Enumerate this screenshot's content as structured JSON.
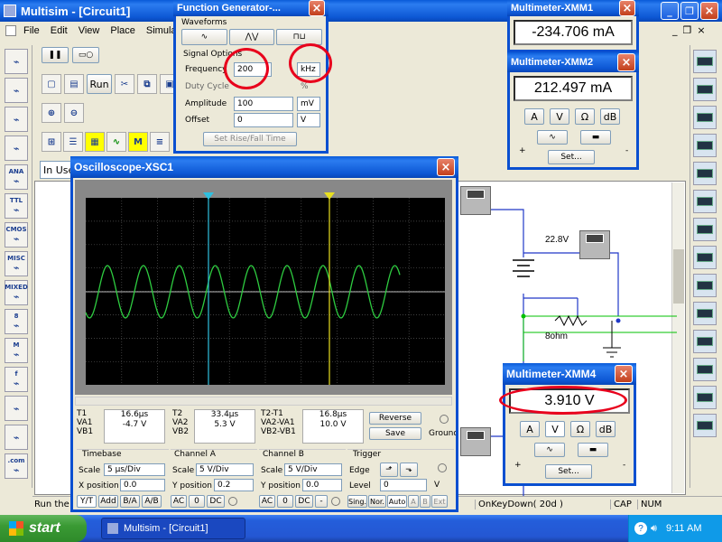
{
  "app": {
    "title": "Multisim - [Circuit1]",
    "menu": [
      "File",
      "Edit",
      "View",
      "Place",
      "Simulat"
    ]
  },
  "toolbar": {
    "run_label": "Run",
    "in_use": "In Use"
  },
  "left_bins": [
    {
      "name": "source-icon",
      "label": ""
    },
    {
      "name": "basic-icon",
      "label": ""
    },
    {
      "name": "diode-icon",
      "label": ""
    },
    {
      "name": "transistor-icon",
      "label": ""
    },
    {
      "name": "analog-icon",
      "label": "ANA"
    },
    {
      "name": "ttl-icon",
      "label": "TTL"
    },
    {
      "name": "cmos-icon",
      "label": "CMOS"
    },
    {
      "name": "misc-icon",
      "label": "MISC"
    },
    {
      "name": "mixed-icon",
      "label": "MIXED"
    },
    {
      "name": "indicator-icon",
      "label": "8"
    },
    {
      "name": "misc2-icon",
      "label": "M"
    },
    {
      "name": "rf-icon",
      "label": "f"
    },
    {
      "name": "electromech-icon",
      "label": ""
    },
    {
      "name": "ladder-icon",
      "label": ""
    },
    {
      "name": "web-icon",
      "label": ".com"
    }
  ],
  "func_gen": {
    "title": "Function Generator-...",
    "waveforms_label": "Waveforms",
    "signal_options_label": "Signal Options",
    "frequency_label": "Frequency",
    "frequency_value": "200",
    "frequency_unit": "kHz",
    "duty_label": "Duty Cycle",
    "duty_unit": "%",
    "amplitude_label": "Amplitude",
    "amplitude_value": "100",
    "amplitude_unit": "mV",
    "offset_label": "Offset",
    "offset_value": "0",
    "offset_unit": "V",
    "rise_fall_label": "Set Rise/Fall Time"
  },
  "xmm1": {
    "title": "Multimeter-XMM1",
    "reading": "-234.706 mA"
  },
  "xmm2": {
    "title": "Multimeter-XMM2",
    "reading": "212.497 mA",
    "btns": [
      "A",
      "V",
      "Ω",
      "dB"
    ],
    "set": "Set...",
    "plus": "+",
    "minus": "-"
  },
  "xmm4": {
    "title": "Multimeter-XMM4",
    "reading": "3.910  V",
    "btns": [
      "A",
      "V",
      "Ω",
      "dB"
    ],
    "set": "Set...",
    "plus": "+",
    "minus": "-"
  },
  "scope": {
    "title": "Oscilloscope-XSC1",
    "t1": {
      "label": "T1",
      "time": "16.6µs",
      "va_label": "VA1",
      "va": "-4.7 V",
      "vb_label": "VB1",
      "vb": ""
    },
    "t2": {
      "label": "T2",
      "time": "33.4µs",
      "va_label": "VA2",
      "va": "5.3 V",
      "vb_label": "VB2",
      "vb": ""
    },
    "t21": {
      "label": "T2-T1",
      "time": "16.8µs",
      "va_label": "VA2-VA1",
      "va": "10.0 V",
      "vb_label": "VB2-VB1",
      "vb": ""
    },
    "reverse": "Reverse",
    "save": "Save",
    "ground": "Ground",
    "timebase_label": "Timebase",
    "scale_label": "Scale",
    "timebase_scale": "5 µs/Div",
    "xpos_label": "X position",
    "xpos": "0.0",
    "yt": "Y/T",
    "add": "Add",
    "ba": "B/A",
    "ab": "A/B",
    "cha_label": "Channel A",
    "cha_scale": "5 V/Div",
    "cha_ypos_label": "Y position",
    "cha_ypos": "0.2",
    "chb_label": "Channel B",
    "chb_scale": "5 V/Div",
    "chb_ypos_label": "Y position",
    "chb_ypos": "0.0",
    "ac": "AC",
    "zero": "0",
    "dc": "DC",
    "minus": "-",
    "trigger_label": "Trigger",
    "edge_label": "Edge",
    "level_label": "Level",
    "level": "0",
    "level_unit": "V",
    "sing": "Sing.",
    "nor": "Nor.",
    "auto": "Auto",
    "a": "A",
    "b": "B",
    "ext": "Ext"
  },
  "circuit": {
    "voltage_label": "22.8V",
    "resistor_label": "8ohm"
  },
  "status": {
    "left": "Run the",
    "event": "OnKeyDown( 20d )",
    "caps": "CAP",
    "num": "NUM"
  },
  "taskbar": {
    "start": "start",
    "task": "Multisim - [Circuit1]",
    "time": "9:11 AM"
  }
}
